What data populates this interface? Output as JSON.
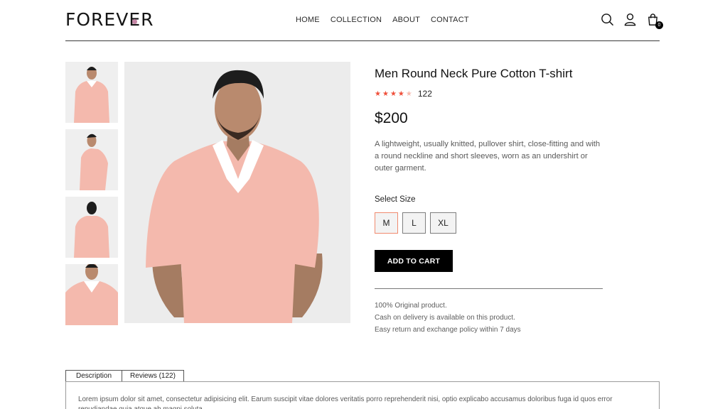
{
  "header": {
    "logo": "FOREVER",
    "nav": [
      "HOME",
      "COLLECTION",
      "ABOUT",
      "CONTACT"
    ],
    "cart_count": "0"
  },
  "product": {
    "title": "Men Round Neck Pure Cotton T-shirt",
    "rating": 4,
    "rating_max": 5,
    "review_count": "122",
    "price": "$200",
    "description": "A lightweight, usually knitted, pullover shirt, close-fitting and with a round neckline and short sleeves, worn as an undershirt or outer garment.",
    "size_label": "Select Size",
    "sizes": [
      "M",
      "L",
      "XL"
    ],
    "selected_size": "M",
    "add_to_cart": "ADD TO CART",
    "policies": [
      "100% Original product.",
      "Cash on delivery is available on this product.",
      "Easy return and exchange policy within 7 days"
    ]
  },
  "tabs": {
    "description": "Description",
    "reviews": "Reviews (122)",
    "panel_text": "Lorem ipsum dolor sit amet, consectetur adipisicing elit. Earum suscipit vitae dolores veritatis porro reprehenderit nisi, optio explicabo accusamus doloribus fuga id quos error repudiandae quia atque ab magni soluta."
  },
  "colors": {
    "accent_star": "#ef4f3a",
    "selected_border": "#f08a6f",
    "shirt": "#f4b9ad",
    "logo_dot": "#c586a5"
  }
}
